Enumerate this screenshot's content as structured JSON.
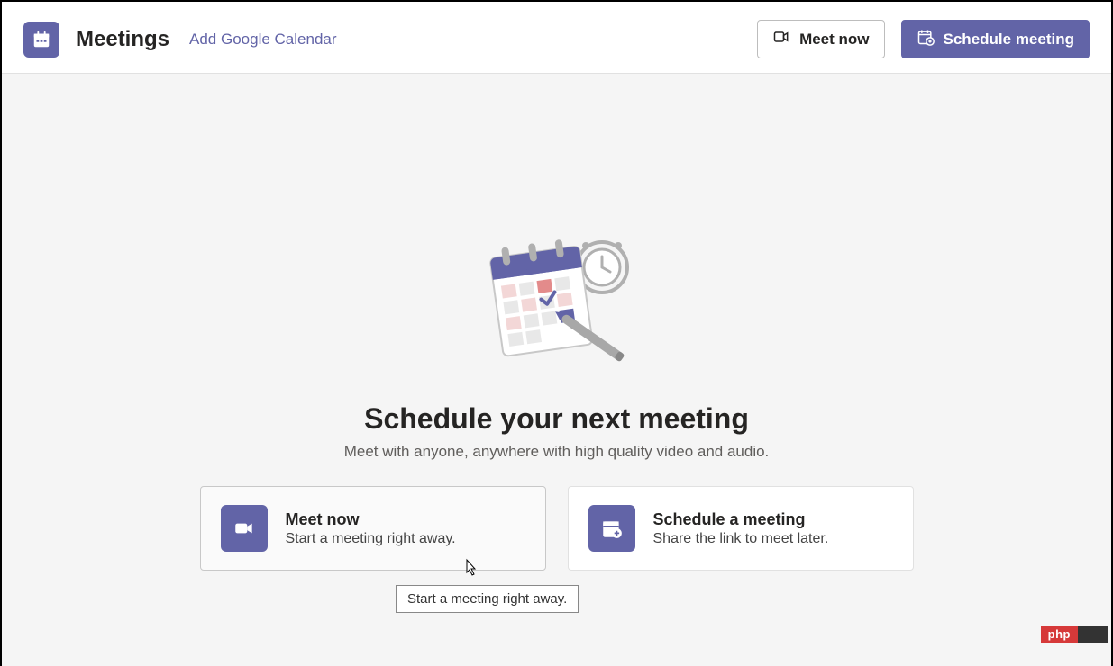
{
  "header": {
    "title": "Meetings",
    "add_calendar_link": "Add Google Calendar",
    "meet_now_btn": "Meet now",
    "schedule_btn": "Schedule meeting"
  },
  "main": {
    "heading": "Schedule your next meeting",
    "subtext": "Meet with anyone, anywhere with high quality video and audio."
  },
  "cards": {
    "meet_now": {
      "title": "Meet now",
      "desc": "Start a meeting right away."
    },
    "schedule": {
      "title": "Schedule a meeting",
      "desc": "Share the link to meet later."
    }
  },
  "tooltip": "Start a meeting right away.",
  "watermark": {
    "left": "php",
    "right": "—"
  }
}
